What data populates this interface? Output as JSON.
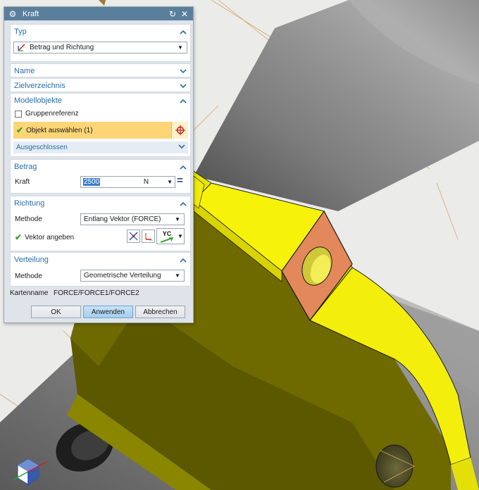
{
  "dialog": {
    "title": "Kraft",
    "typ": {
      "header": "Typ",
      "selected": "Betrag und Richtung"
    },
    "name": {
      "header": "Name"
    },
    "zielverzeichnis": {
      "header": "Zielverzeichnis"
    },
    "modellobjekte": {
      "header": "Modellobjekte",
      "group_ref_label": "Gruppenreferenz",
      "group_ref_checked": false,
      "select_label": "Objekt auswählen (1)",
      "excluded_label": "Ausgeschlossen"
    },
    "betrag": {
      "header": "Betrag",
      "kraft_label": "Kraft",
      "kraft_value": "2500",
      "unit": "N",
      "eq_symbol": "="
    },
    "richtung": {
      "header": "Richtung",
      "methode_label": "Methode",
      "methode_value": "Entlang Vektor (FORCE)",
      "vector_label": "Vektor angeben",
      "vector_option": "YC"
    },
    "verteilung": {
      "header": "Verteilung",
      "methode_label": "Methode",
      "methode_value": "Geometrische Verteilung"
    },
    "kartenname_label": "Kartenname",
    "kartenname_value": "FORCE/FORCE1/FORCE2",
    "buttons": {
      "ok": "OK",
      "apply": "Anwenden",
      "cancel": "Abbrechen"
    }
  },
  "icons": {
    "dialog": "gear-icon",
    "reset": "reset-icon",
    "close": "close-icon",
    "typ": "force-type-icon",
    "select": "crosshair-icon",
    "vector_dialog": "vector-dialog-icon",
    "vector_inferred": "inferred-vector-icon",
    "triad": "view-triad-icon"
  },
  "colors": {
    "title_bar": "#5a7f9c",
    "section_header": "#2a6ea8",
    "selection_highlight": "#fcd577",
    "part_yellow": "#f5f00a",
    "selected_face": "#e38a5a",
    "cylinder_gray": "#7f7f7f",
    "button_primary": "#a5cfee"
  }
}
